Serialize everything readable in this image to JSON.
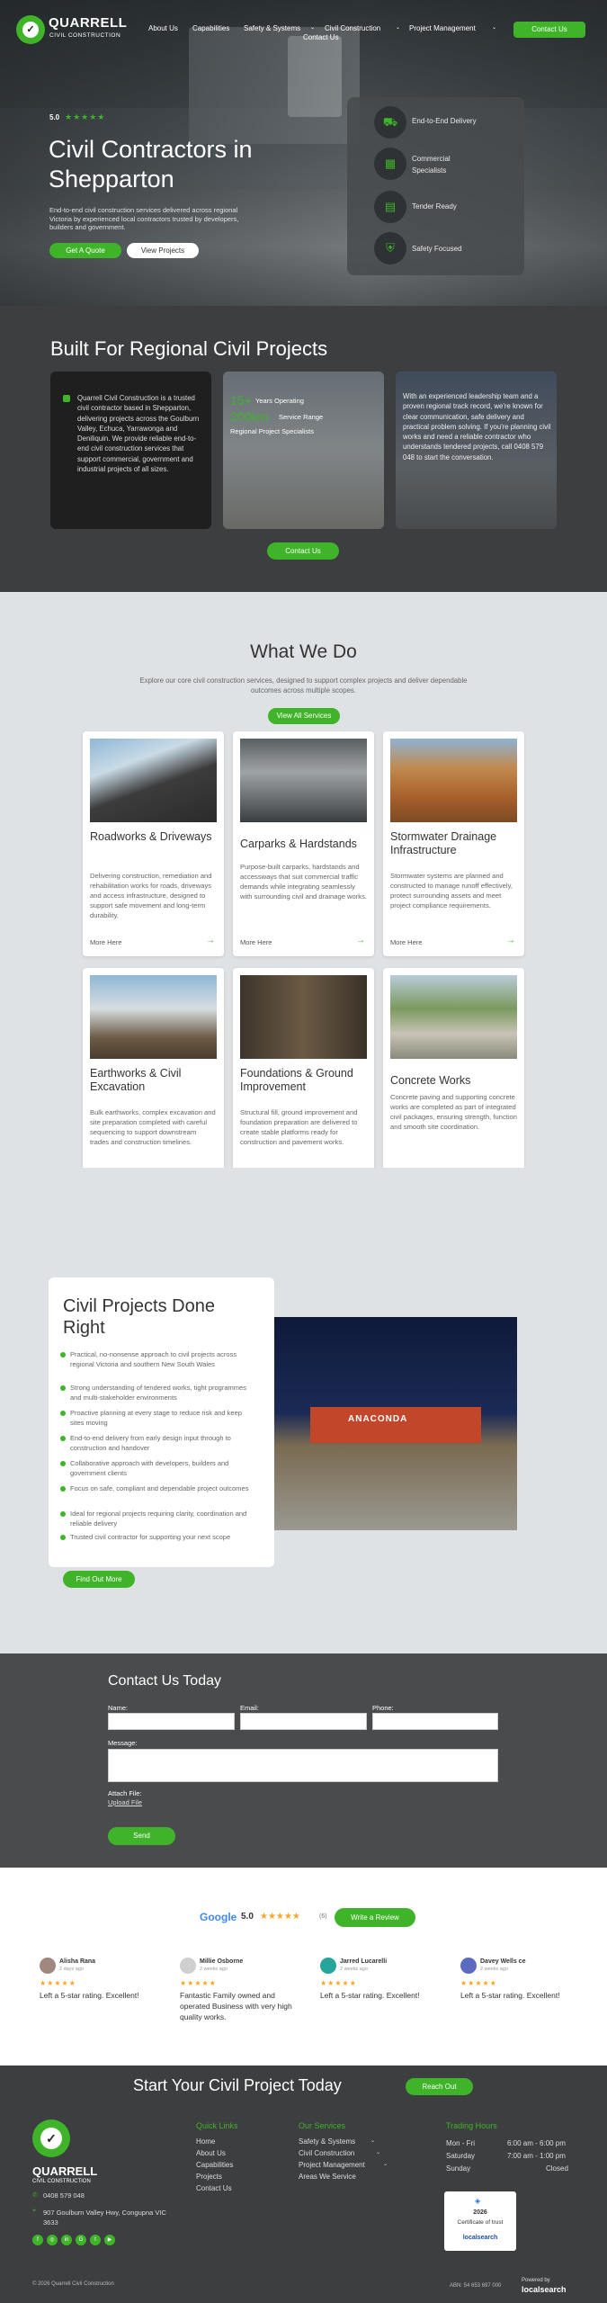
{
  "header": {
    "brand": "QUARRELL",
    "brand_sub": "CIVIL CONSTRUCTION",
    "nav": [
      "About Us",
      "Capabilities",
      "Safety & Systems",
      "Civil Construction",
      "Project Management",
      "Contact Us"
    ],
    "cta": "Contact Us"
  },
  "hero": {
    "rating": "5.0",
    "stars": "★★★★★",
    "title": "Civil Contractors in Shepparton",
    "subtitle": "End-to-end civil construction services delivered across regional Victoria by experienced local contractors trusted by developers, builders and government.",
    "btn_quote": "Get A Quote",
    "btn_projects": "View Projects",
    "features": [
      "End-to-End Delivery",
      "Commercial Specialists",
      "Tender Ready",
      "Safety Focused"
    ]
  },
  "built": {
    "title": "Built For Regional Civil Projects",
    "card1": "Quarrell Civil Construction is a trusted civil contractor based in Shepparton, delivering projects across the Goulburn Valley, Echuca, Yarrawonga and Deniliquin. We provide reliable end-to-end civil construction services that support commercial, government and industrial projects of all sizes.",
    "stat1_num": "15+",
    "stat1_label": "Years Operating",
    "stat2_num": "200km",
    "stat2_label": "Service Range",
    "stat3_label": "Regional Project Specialists",
    "card3": "With an experienced leadership team and a proven regional track record, we're known for clear communication, safe delivery and practical problem solving. If you're planning civil works and need a reliable contractor who understands tendered projects, call 0408 579 048 to start the conversation.",
    "cta": "Contact Us"
  },
  "services": {
    "title": "What We Do",
    "intro": "Explore our core civil construction services, designed to support complex projects and deliver dependable outcomes across multiple scopes.",
    "cta": "View All Services",
    "more": "More Here",
    "items": [
      {
        "title": "Roadworks & Driveways",
        "desc": "Delivering construction, remediation and rehabilitation works for roads, driveways and access infrastructure, designed to support safe movement and long-term durability."
      },
      {
        "title": "Carparks & Hardstands",
        "desc": "Purpose-built carparks, hardstands and accessways that suit commercial traffic demands while integrating seamlessly with surrounding civil and drainage works."
      },
      {
        "title": "Stormwater Drainage Infrastructure",
        "desc": "Stormwater systems are planned and constructed to manage runoff effectively, protect surrounding assets and meet project compliance requirements."
      },
      {
        "title": "Earthworks & Civil Excavation",
        "desc": "Bulk earthworks, complex excavation and site preparation completed with careful sequencing to support downstream trades and construction timelines."
      },
      {
        "title": "Foundations & Ground Improvement",
        "desc": "Structural fill, ground improvement and foundation preparation are delivered to create stable platforms ready for construction and pavement works."
      },
      {
        "title": "Concrete Works",
        "desc": "Concrete paving and supporting concrete works are completed as part of integrated civil packages, ensuring strength, function and smooth site coordination."
      }
    ]
  },
  "projects": {
    "title": "Civil Projects Done Right",
    "points": [
      "Practical, no-nonsense approach to civil projects across regional Victoria and southern New South Wales",
      "Strong understanding of tendered works, tight programmes and multi-stakeholder environments",
      "Proactive planning at every stage to reduce risk and keep sites moving",
      "End-to-end delivery from early design input through to construction and handover",
      "Collaborative approach with developers, builders and government clients",
      "Focus on safe, compliant and dependable project outcomes",
      "Ideal for regional projects requiring clarity, coordination and reliable delivery",
      "Trusted civil contractor for supporting your next scope"
    ],
    "cta": "Find Out More",
    "sign": "ANACONDA"
  },
  "contact": {
    "title": "Contact Us Today",
    "name": "Name:",
    "email": "Email:",
    "phone": "Phone:",
    "message": "Message:",
    "attach": "Attach File:",
    "upload": "Upload File",
    "send": "Send"
  },
  "reviews": {
    "google": "Google",
    "rating": "5.0",
    "stars": "★★★★★",
    "count": "(6)",
    "cta": "Write a Review",
    "items": [
      {
        "name": "Alisha Rana",
        "ago": "2 days ago",
        "text": "Left a 5-star rating. Excellent!"
      },
      {
        "name": "Millie Osborne",
        "ago": "2 weeks ago",
        "text": "Fantastic Family owned and operated Business with very high quality works."
      },
      {
        "name": "Jarred Lucarelli",
        "ago": "2 weeks ago",
        "text": "Left a 5-star rating. Excellent!"
      },
      {
        "name": "Davey Wells ce",
        "ago": "2 weeks ago",
        "text": "Left a 5-star rating. Excellent!"
      }
    ]
  },
  "footer": {
    "cta_title": "Start Your Civil Project Today",
    "cta": "Reach Out",
    "brand": "QUARRELL",
    "brand_sub": "CIVIL CONSTRUCTION",
    "phone": "0408 579 048",
    "address": "907 Goulburn Valley Hwy, Congupna VIC 3633",
    "quick_title": "Quick Links",
    "quick": [
      "Home",
      "About Us",
      "Capabilities",
      "Projects",
      "Contact Us"
    ],
    "services_title": "Our Services",
    "services": [
      "Safety & Systems",
      "Civil Construction",
      "Project Management",
      "Areas We Service"
    ],
    "hours_title": "Trading Hours",
    "hours": [
      {
        "day": "Mon - Fri",
        "time": "6:00 am - 6:00 pm"
      },
      {
        "day": "Saturday",
        "time": "7:00 am - 1:00 pm"
      },
      {
        "day": "Sunday",
        "time": "Closed"
      }
    ],
    "badge_year": "2026",
    "badge_text": "Certificate of trust",
    "badge_brand": "localsearch",
    "copyright": "© 2026 Quarrell Civil Construction",
    "abn": "ABN: 54 653 697 000",
    "powered": "Powered by",
    "powered_brand": "localsearch"
  }
}
